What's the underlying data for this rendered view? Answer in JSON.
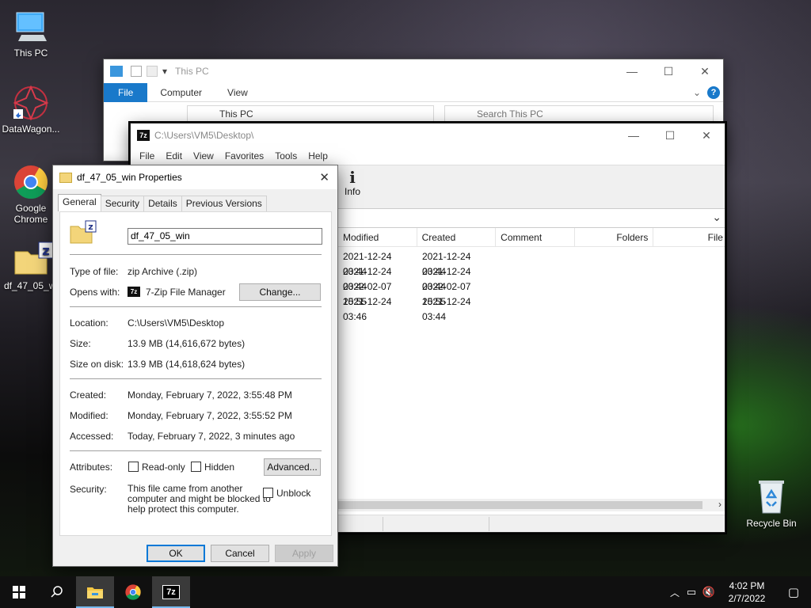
{
  "desktop": {
    "icons": [
      {
        "label": "This PC",
        "icon": "computer-icon"
      },
      {
        "label": "DataWagon...",
        "icon": "datawagon-icon"
      },
      {
        "label": "Google Chrome",
        "icon": "chrome-icon"
      },
      {
        "label": "df_47_05_wi",
        "icon": "zip-folder-icon"
      },
      {
        "label": "Recycle Bin",
        "icon": "recycle-bin-icon"
      }
    ]
  },
  "explorer": {
    "title": "This PC",
    "tabs": [
      "File",
      "Computer",
      "View"
    ],
    "address": "This PC",
    "search_placeholder": "Search This PC"
  },
  "sevenzip": {
    "title": "C:\\Users\\VM5\\Desktop\\",
    "menu": [
      "File",
      "Edit",
      "View",
      "Favorites",
      "Tools",
      "Help"
    ],
    "toolbar_info": "Info",
    "columns": [
      "Modified",
      "Created",
      "Comment",
      "Folders",
      "File"
    ],
    "rows": [
      {
        "modified": "2021-12-24 03:44",
        "created": "2021-12-24 03:44"
      },
      {
        "modified": "2021-12-24 03:44",
        "created": "2021-12-24 03:44"
      },
      {
        "modified": "2022-02-07 15:55",
        "created": "2022-02-07 15:55"
      },
      {
        "modified": "2021-12-24 03:46",
        "created": "2021-12-24 03:44"
      }
    ]
  },
  "properties": {
    "title": "df_47_05_win Properties",
    "tabs": [
      "General",
      "Security",
      "Details",
      "Previous Versions"
    ],
    "filename": "df_47_05_win",
    "type_label": "Type of file:",
    "type_value": "zip Archive (.zip)",
    "opens_label": "Opens with:",
    "opens_value": "7-Zip File Manager",
    "change_button": "Change...",
    "location_label": "Location:",
    "location_value": "C:\\Users\\VM5\\Desktop",
    "size_label": "Size:",
    "size_value": "13.9 MB (14,616,672 bytes)",
    "size_disk_label": "Size on disk:",
    "size_disk_value": "13.9 MB (14,618,624 bytes)",
    "created_label": "Created:",
    "created_value": "Monday, February 7, 2022, 3:55:48 PM",
    "modified_label": "Modified:",
    "modified_value": "Monday, February 7, 2022, 3:55:52 PM",
    "accessed_label": "Accessed:",
    "accessed_value": "Today, February 7, 2022, 3 minutes ago",
    "attributes_label": "Attributes:",
    "readonly_label": "Read-only",
    "hidden_label": "Hidden",
    "advanced_button": "Advanced...",
    "security_label": "Security:",
    "security_line1": "This file came from another",
    "security_line2": "computer and might be blocked to",
    "security_line3": "help protect this computer.",
    "unblock_label": "Unblock",
    "ok_button": "OK",
    "cancel_button": "Cancel",
    "apply_button": "Apply"
  },
  "taskbar": {
    "time": "4:02 PM",
    "date": "2/7/2022"
  }
}
